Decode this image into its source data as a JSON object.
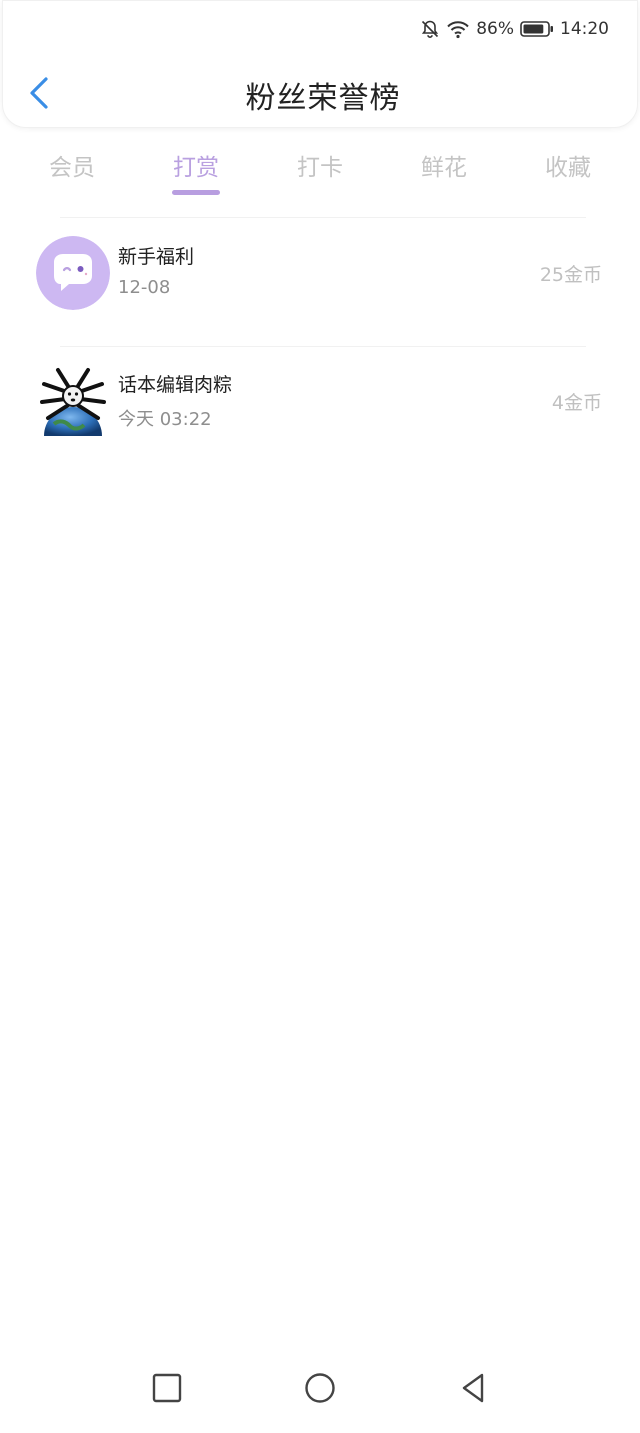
{
  "status_bar": {
    "battery_percent": "86%",
    "time": "14:20",
    "icons": [
      "bell-off-icon",
      "wifi-icon",
      "battery-icon"
    ],
    "battery_level": 0.86
  },
  "header": {
    "title": "粉丝荣誉榜",
    "back_icon": "chevron-left-icon",
    "accent_color": "#3a8ee6"
  },
  "tabs": [
    {
      "label": "会员",
      "active": false
    },
    {
      "label": "打赏",
      "active": true
    },
    {
      "label": "打卡",
      "active": false
    },
    {
      "label": "鲜花",
      "active": false
    },
    {
      "label": "收藏",
      "active": false
    }
  ],
  "active_color": "#b89ee0",
  "list": [
    {
      "name": "新手福利",
      "time": "12-08",
      "amount": "25金币",
      "avatar": "chat-bubble-avatar"
    },
    {
      "name": "话本编辑肉粽",
      "time": "今天 03:22",
      "amount": "4金币",
      "avatar": "cartoon-globe-avatar"
    }
  ],
  "nav_bar": {
    "icons": [
      "recent-apps-icon",
      "home-icon",
      "back-triangle-icon"
    ]
  }
}
